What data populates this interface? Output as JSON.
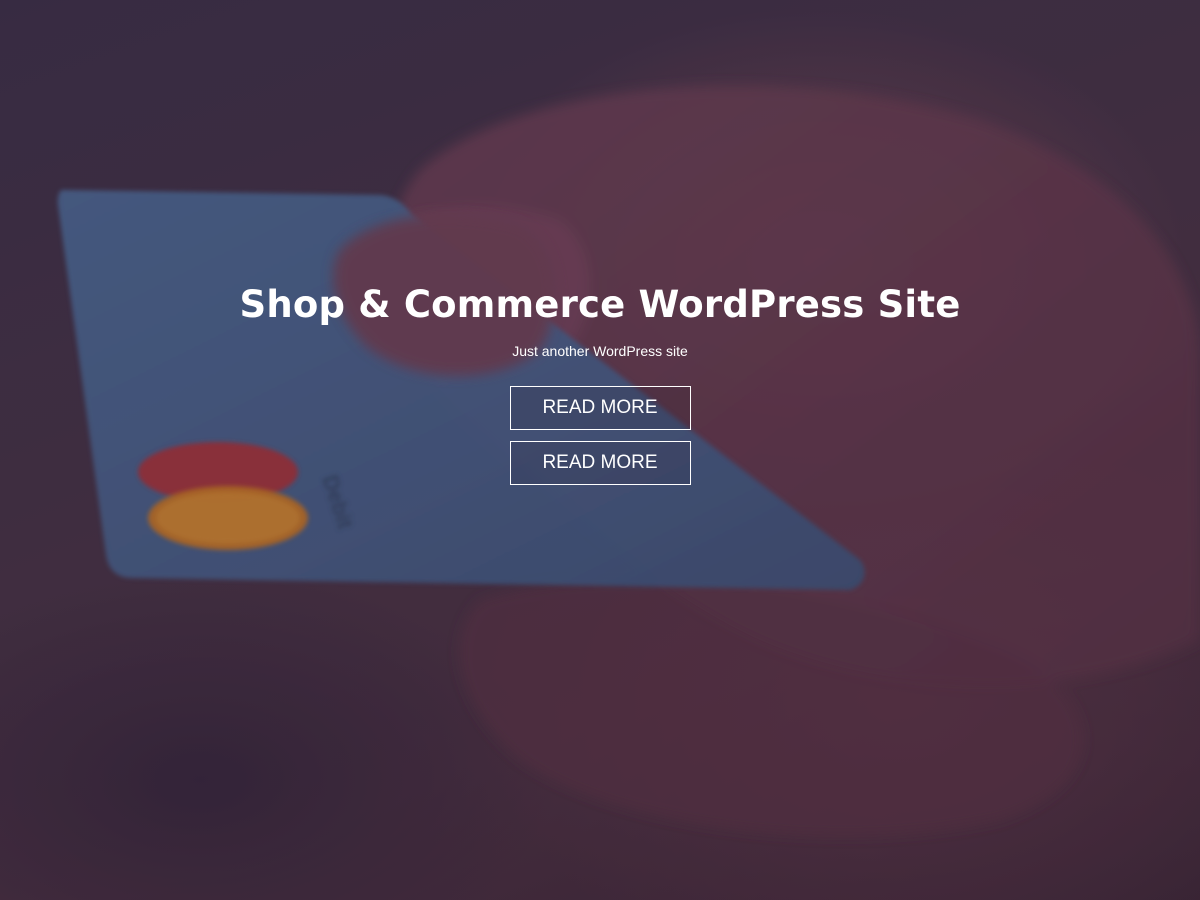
{
  "hero": {
    "title": "Shop & Commerce WordPress Site",
    "tagline": "Just another WordPress site",
    "buttons": [
      {
        "label": "READ MORE"
      },
      {
        "label": "READ MORE"
      }
    ],
    "background_image": {
      "subject": "hand-holding-debit-card",
      "card_text": "Debit",
      "overlay_color": "#3a2c3e"
    }
  },
  "colors": {
    "text": "#ffffff",
    "card_blue": "#4a6a96",
    "card_red": "#b0303a",
    "card_orange": "#c87a2a"
  }
}
